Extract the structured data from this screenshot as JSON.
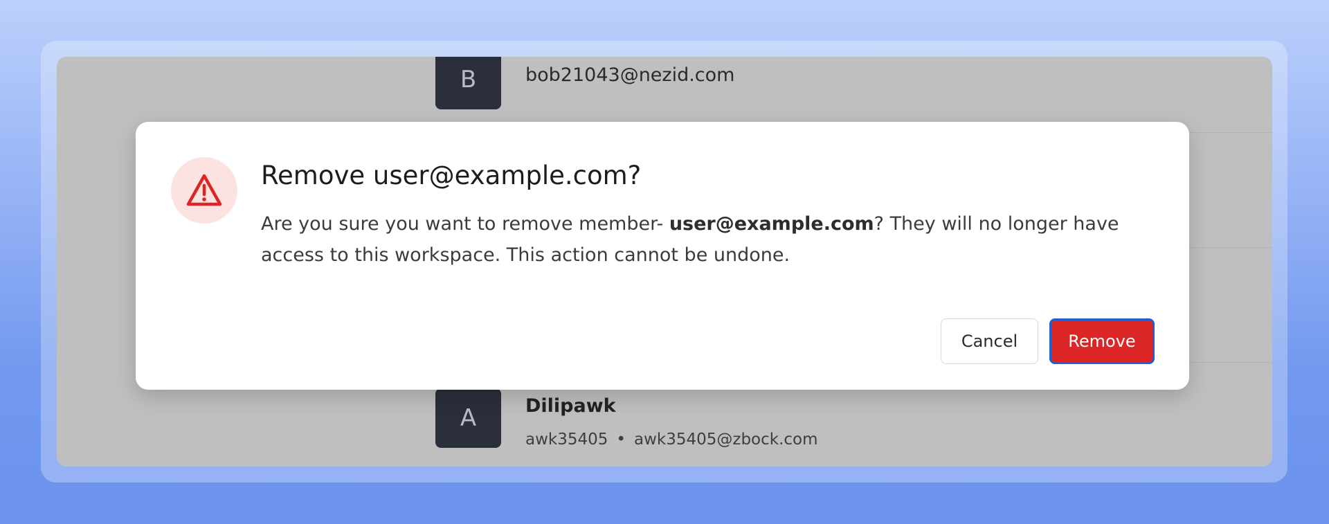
{
  "members": [
    {
      "avatar_letter": "B",
      "email": "bob21043@nezid.com"
    },
    {
      "avatar_letter": "A",
      "name": "Dilipawk",
      "username": "awk35405",
      "separator": "•",
      "email": "awk35405@zbock.com"
    }
  ],
  "dialog": {
    "title": "Remove user@example.com?",
    "body_prefix": "Are you sure you want to remove member- ",
    "body_email": "user@example.com",
    "body_suffix": "? They will no longer have access to this workspace. This action cannot be undone.",
    "cancel_label": "Cancel",
    "remove_label": "Remove",
    "icon": "warning-triangle-icon"
  },
  "colors": {
    "danger": "#dc2626",
    "danger_bg": "#fde2e2",
    "focus_ring": "#1d5fd6",
    "avatar_bg": "#2a2f3b",
    "overlay": "#bfbfbf"
  }
}
